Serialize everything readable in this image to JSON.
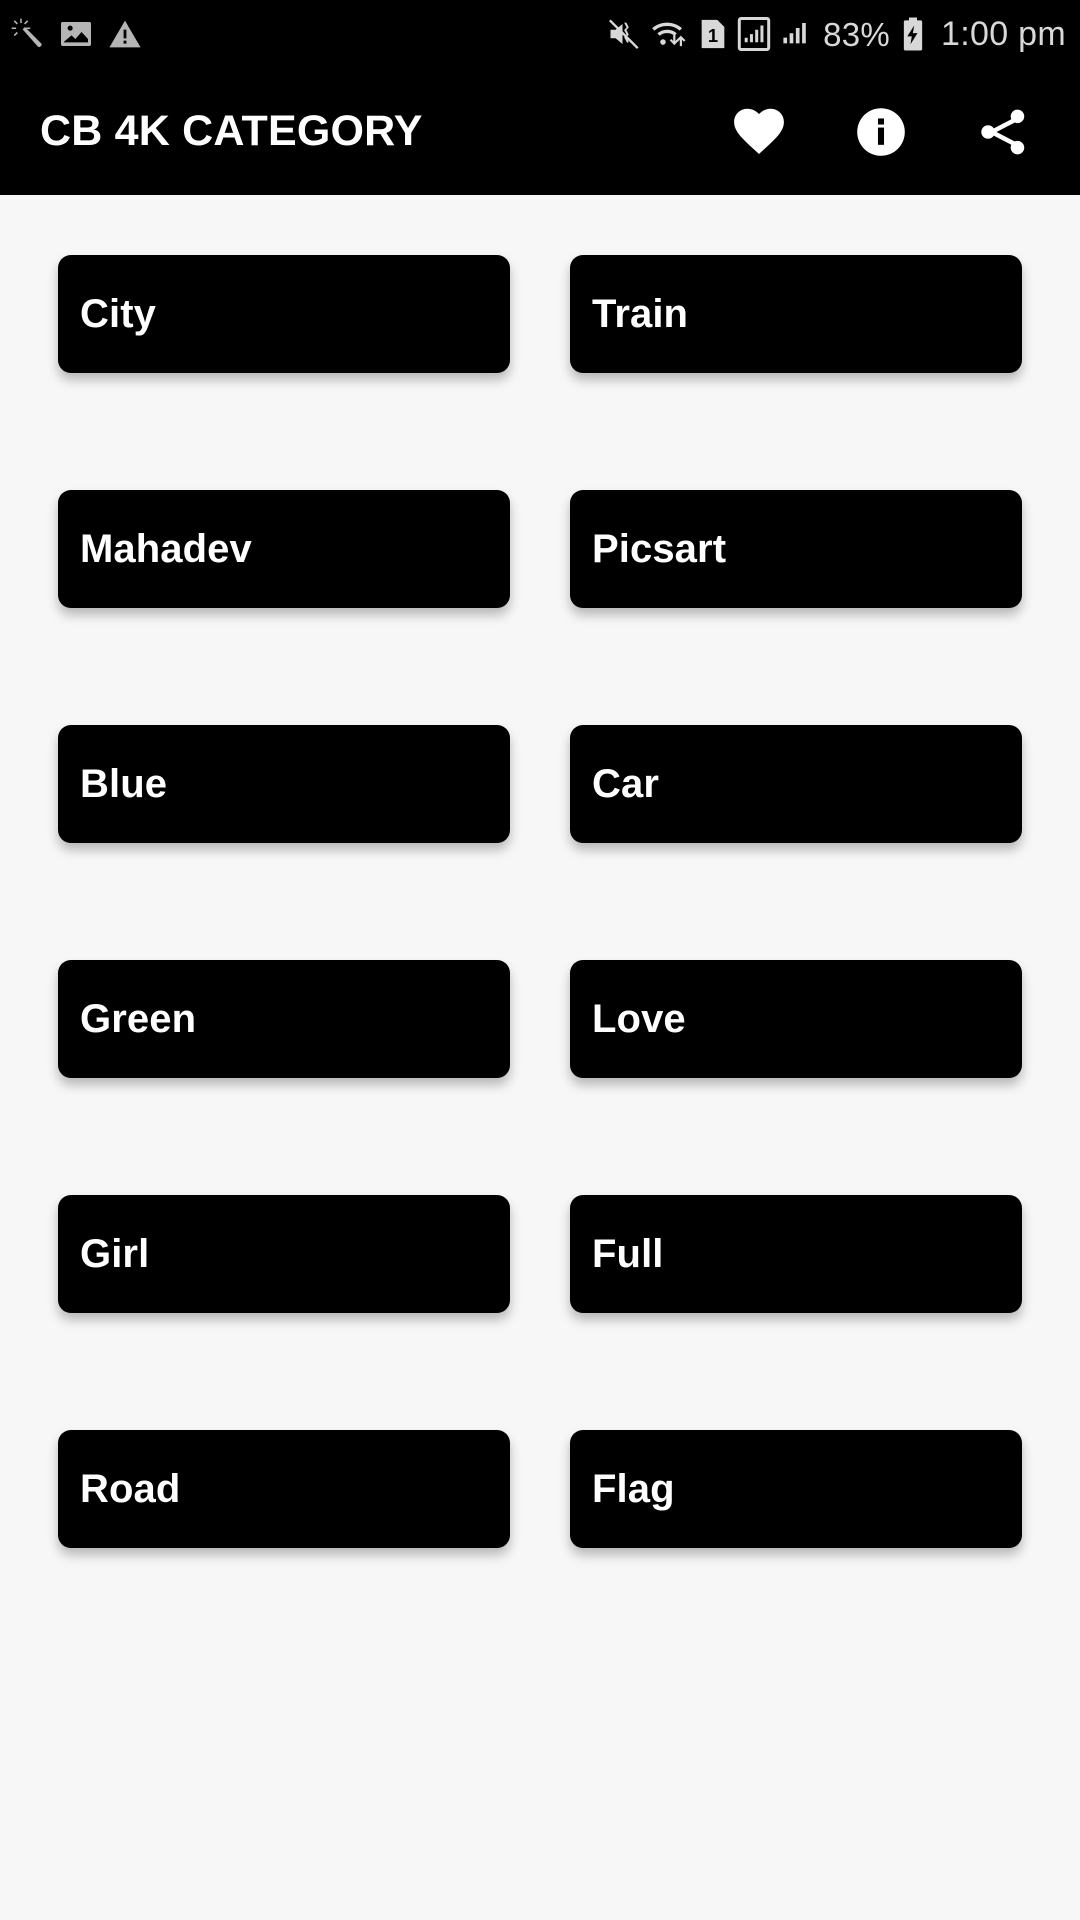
{
  "status_bar": {
    "left_icons": [
      {
        "name": "magic-wand-icon"
      },
      {
        "name": "image-icon"
      },
      {
        "name": "warning-triangle-icon"
      }
    ],
    "right_icons": [
      {
        "name": "volume-mute-vibrate-icon"
      },
      {
        "name": "wifi-data-icon"
      },
      {
        "name": "sim-1-icon",
        "label": "1"
      },
      {
        "name": "signal-boxed-icon"
      },
      {
        "name": "signal-bars-icon"
      }
    ],
    "battery_percent": "83%",
    "battery_icon": "battery-charging-icon",
    "clock": "1:00 pm"
  },
  "app_bar": {
    "title": "CB 4K CATEGORY",
    "actions": [
      {
        "name": "favorite-heart-icon",
        "label": "Favorite"
      },
      {
        "name": "info-circle-icon",
        "label": "Info"
      },
      {
        "name": "share-icon",
        "label": "Share"
      }
    ]
  },
  "categories": [
    {
      "label": "City"
    },
    {
      "label": "Train"
    },
    {
      "label": "Mahadev"
    },
    {
      "label": "Picsart"
    },
    {
      "label": "Blue"
    },
    {
      "label": "Car"
    },
    {
      "label": "Green"
    },
    {
      "label": "Love"
    },
    {
      "label": "Girl"
    },
    {
      "label": "Full"
    },
    {
      "label": "Road"
    },
    {
      "label": "Flag"
    }
  ],
  "colors": {
    "bar_background": "#000000",
    "page_background": "#f7f7f7",
    "card_background": "#000000",
    "card_text": "#ffffff",
    "status_icon": "#b5b5b5",
    "status_text": "#d8d8d8"
  }
}
